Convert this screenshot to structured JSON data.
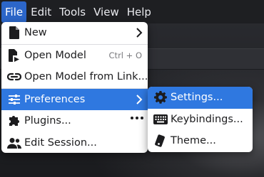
{
  "menubar": {
    "items": [
      "File",
      "Edit",
      "Tools",
      "View",
      "Help"
    ],
    "active": "File"
  },
  "file_menu": {
    "items": [
      {
        "label": "New",
        "icon": "file-icon",
        "submenu": true
      },
      {
        "label": "Open Model",
        "icon": "file-open-icon",
        "shortcut": "Ctrl + O"
      },
      {
        "label": "Open Model from Link...",
        "icon": "link-icon"
      },
      {
        "label": "Preferences",
        "icon": "sliders-icon",
        "submenu": true,
        "highlighted": true
      },
      {
        "label": "Plugins...",
        "icon": "puzzle-icon",
        "more": true
      },
      {
        "label": "Edit Session...",
        "icon": "users-icon"
      }
    ]
  },
  "preferences_submenu": {
    "items": [
      {
        "label": "Settings...",
        "icon": "gear-icon",
        "highlighted": true
      },
      {
        "label": "Keybindings...",
        "icon": "keyboard-icon"
      },
      {
        "label": "Theme...",
        "icon": "palette-icon"
      }
    ]
  },
  "colors": {
    "menubar_bg": "#1e1f22",
    "accent": "#2f78e0",
    "menu_bg": "#ffffff"
  }
}
